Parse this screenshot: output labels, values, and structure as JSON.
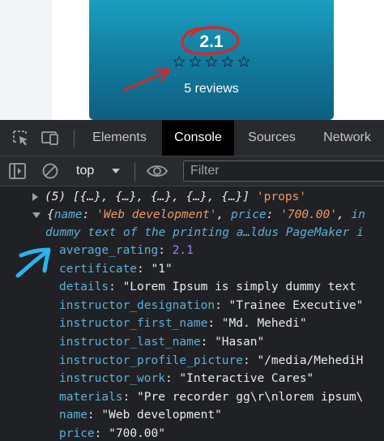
{
  "card": {
    "rating": "2.1",
    "star_count": 5,
    "reviews": "5 reviews"
  },
  "devtools": {
    "tabs": [
      {
        "label": "Elements",
        "active": false
      },
      {
        "label": "Console",
        "active": true
      },
      {
        "label": "Sources",
        "active": false
      },
      {
        "label": "Network",
        "active": false
      }
    ],
    "toolbar": {
      "context": "top",
      "filter_placeholder": "Filter"
    },
    "console": {
      "array_summary": "(5) [{…}, {…}, {…}, {…}, {…}]",
      "array_label": "'props'",
      "object_preview": {
        "open": "{",
        "name_key": "name",
        "name_value": "'Web development'",
        "price_key": "price",
        "price_value": "'700.00'",
        "tail": "in",
        "line2": "dummy text of the printing a…ldus PageMaker i"
      },
      "properties": [
        {
          "key": "average_rating",
          "value": "2.1",
          "type": "number"
        },
        {
          "key": "certificate",
          "value": "\"1\"",
          "type": "string"
        },
        {
          "key": "details",
          "value": "\"Lorem Ipsum is simply dummy text",
          "type": "string"
        },
        {
          "key": "instructor_designation",
          "value": "\"Trainee Executive\"",
          "type": "string"
        },
        {
          "key": "instructor_first_name",
          "value": "\"Md. Mehedi\"",
          "type": "string"
        },
        {
          "key": "instructor_last_name",
          "value": "\"Hasan\"",
          "type": "string"
        },
        {
          "key": "instructor_profile_picture",
          "value": "\"/media/MehediH",
          "type": "string"
        },
        {
          "key": "instructor_work",
          "value": "\"Interactive Cares\"",
          "type": "string"
        },
        {
          "key": "materials",
          "value": "\"Pre recorder gg\\r\\nlorem ipsum\\",
          "type": "string"
        },
        {
          "key": "name",
          "value": "\"Web development\"",
          "type": "string"
        },
        {
          "key": "price",
          "value": "\"700.00\"",
          "type": "string"
        }
      ]
    }
  },
  "colors": {
    "card_top": "#1a9fc1",
    "card_bottom": "#0d5f80",
    "annotation_red": "#d62828",
    "annotation_blue": "#2ab4f0",
    "console_key": "#5db0d7",
    "console_string": "#f29766",
    "console_number": "#9980ff"
  },
  "icons": [
    "inspect-element-icon",
    "device-toolbar-icon",
    "sidebar-toggle-icon",
    "clear-console-icon",
    "eye-icon",
    "star-icon"
  ]
}
